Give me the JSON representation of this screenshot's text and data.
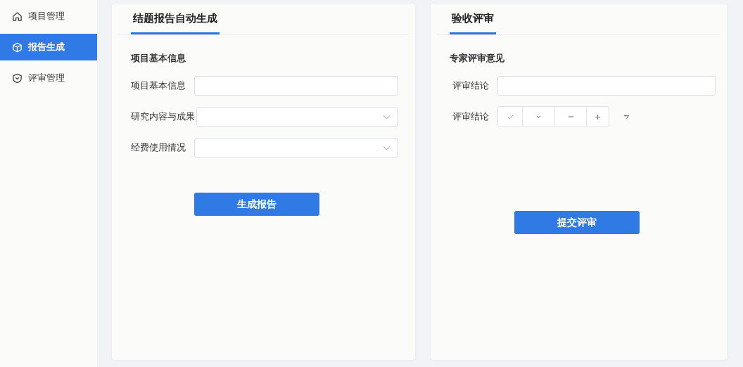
{
  "sidebar": {
    "items": [
      {
        "label": "项目管理",
        "selected": false
      },
      {
        "label": "报告生成",
        "selected": true
      },
      {
        "label": "评审管理",
        "selected": false
      }
    ]
  },
  "report_panel": {
    "tab": {
      "label": "结题报告自动生成",
      "selected": true
    },
    "section": "项目基本信息",
    "fields": [
      {
        "label": "项目基本信息",
        "kind": "text"
      },
      {
        "label": "研究内容与成果",
        "kind": "select"
      },
      {
        "label": "经费使用情况",
        "kind": "select"
      }
    ],
    "button": "生成报告"
  },
  "review_panel": {
    "tab": {
      "label": "验收评审",
      "selected": true
    },
    "section": "专家评审意见",
    "fields": [
      {
        "label": "评审结论",
        "kind": "text"
      }
    ],
    "conclusion": {
      "label": "评审结论",
      "segments": [
        {
          "kind": "check"
        },
        {
          "kind": "chevron"
        },
        {
          "kind": "minus"
        },
        {
          "kind": "plus"
        }
      ]
    },
    "button": "提交评审"
  }
}
